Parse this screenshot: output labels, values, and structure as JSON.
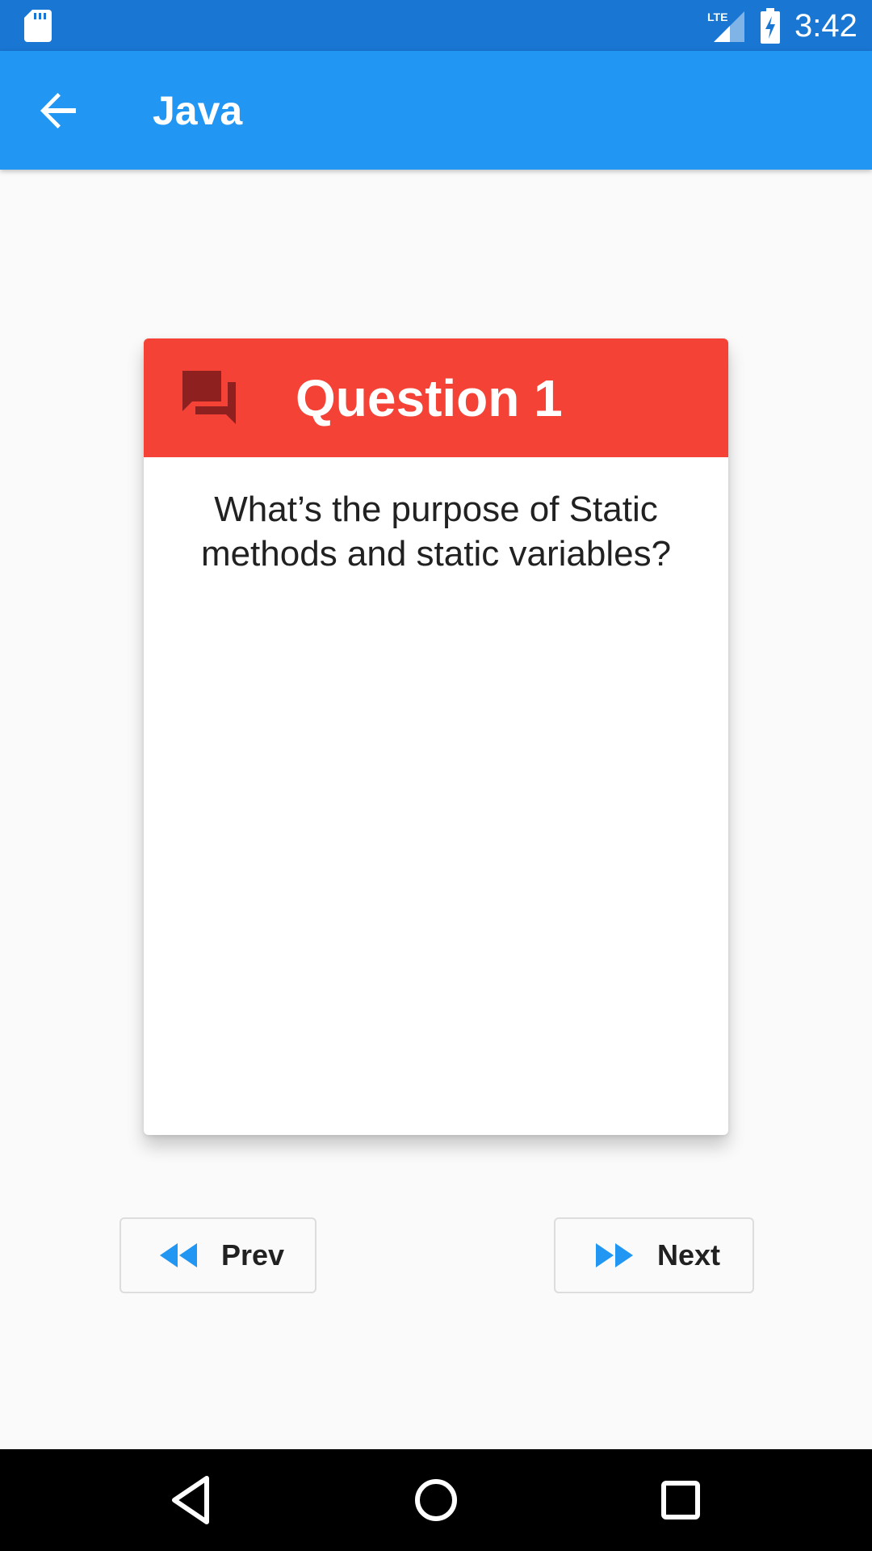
{
  "status_bar": {
    "time": "3:42",
    "network_label": "LTE",
    "icons": [
      "sd-card-icon",
      "signal-icon",
      "battery-charging-icon"
    ]
  },
  "app_bar": {
    "title": "Java",
    "back_icon": "arrow-back-icon"
  },
  "card": {
    "header_icon": "forum-icon",
    "title": "Question 1",
    "question": "What’s the purpose of Static methods and static variables?"
  },
  "navigation": {
    "prev_label": "Prev",
    "prev_icon": "fast-rewind-icon",
    "next_label": "Next",
    "next_icon": "fast-forward-icon"
  },
  "system_nav": {
    "icons": [
      "nav-back-icon",
      "nav-home-icon",
      "nav-recents-icon"
    ]
  },
  "colors": {
    "status_bar": "#1976d2",
    "app_bar": "#2196f3",
    "card_header": "#f44336",
    "header_icon": "#8e2020",
    "nav_accent": "#2196f3",
    "background": "#fafafa"
  }
}
